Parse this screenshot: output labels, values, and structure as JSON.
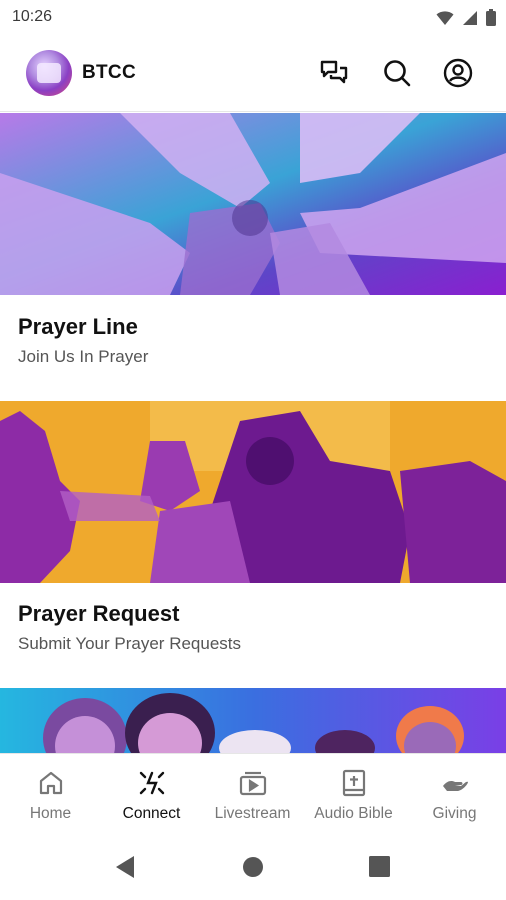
{
  "status_bar": {
    "time": "10:26"
  },
  "header": {
    "title": "BTCC",
    "icons": [
      "chat-icon",
      "search-icon",
      "account-icon"
    ]
  },
  "cards": [
    {
      "title": "Prayer Line",
      "subtitle": "Join Us In Prayer",
      "image": "hands-circle-photo"
    },
    {
      "title": "Prayer Request",
      "subtitle": "Submit Your Prayer Requests",
      "image": "worship-gathering-photo"
    },
    {
      "image": "congregation-faces-photo"
    }
  ],
  "bottom_nav": {
    "active": "Connect",
    "items": [
      {
        "label": "Home",
        "icon": "home-icon"
      },
      {
        "label": "Connect",
        "icon": "connect-icon"
      },
      {
        "label": "Livestream",
        "icon": "livestream-icon"
      },
      {
        "label": "Audio Bible",
        "icon": "bible-icon"
      },
      {
        "label": "Giving",
        "icon": "giving-icon"
      }
    ]
  },
  "colors": {
    "accent_purple": "#9b4fd6",
    "accent_orange": "#f5a623",
    "accent_blue": "#2f8fe0"
  }
}
